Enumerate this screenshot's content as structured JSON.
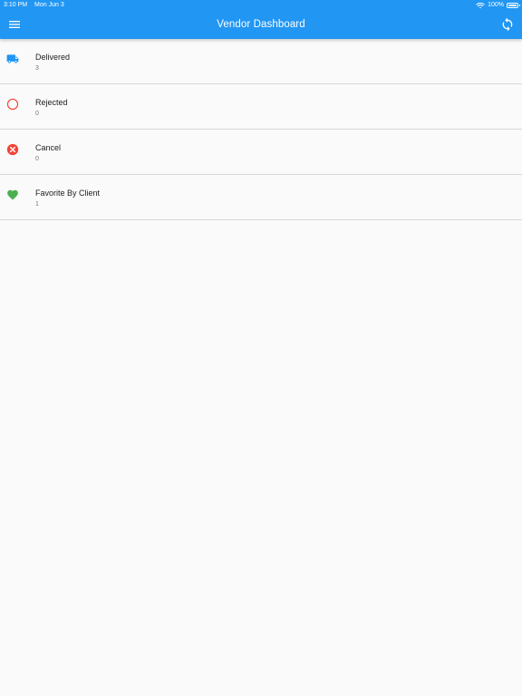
{
  "status_bar": {
    "time": "3:10 PM",
    "date": "Mon Jun 3",
    "battery": "100%",
    "icons": [
      "wifi-icon",
      "battery-icon"
    ]
  },
  "app_bar": {
    "title": "Vendor Dashboard",
    "color": "#2196f3",
    "left_icon": "menu-icon",
    "right_icon": "refresh-icon"
  },
  "items": [
    {
      "label": "Delivered",
      "count": "3",
      "icon": "truck-icon",
      "icon_color": "#2196f3"
    },
    {
      "label": "Rejected",
      "count": "0",
      "icon": "circle-outline-icon",
      "icon_color": "#f44336"
    },
    {
      "label": "Cancel",
      "count": "0",
      "icon": "cancel-icon",
      "icon_color": "#f44336"
    },
    {
      "label": "Favorite By Client",
      "count": "1",
      "icon": "heart-icon",
      "icon_color": "#4caf50"
    }
  ]
}
